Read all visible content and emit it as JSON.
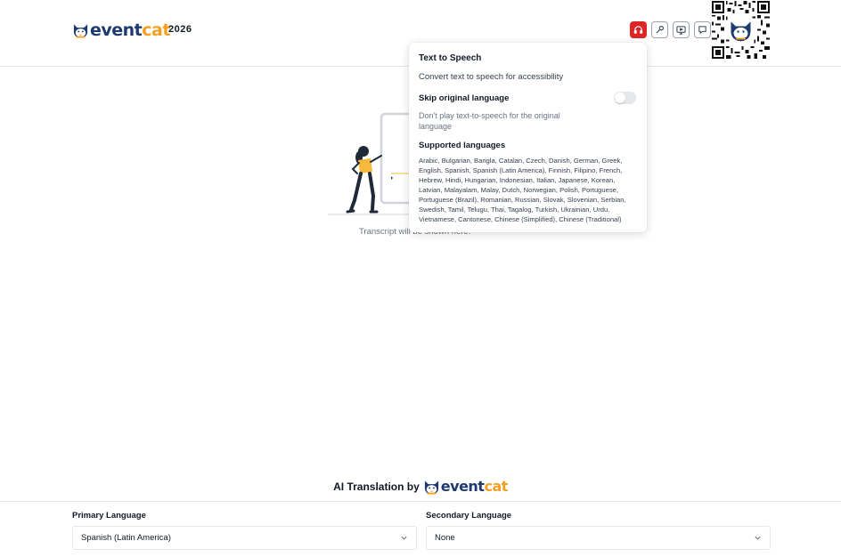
{
  "header": {
    "brand_part1": "event",
    "brand_part2": "cat",
    "year": "2026",
    "icons": [
      "headphones-icon",
      "wrench-icon",
      "screen-icon",
      "chat-icon"
    ],
    "active_color": "#dc2626"
  },
  "main": {
    "transcript_placeholder": "Transcript will be shown here."
  },
  "popover": {
    "title": "Text to Speech",
    "description": "Convert text to speech for accessibility",
    "skip_label": "Skip original language",
    "skip_enabled": false,
    "skip_description": "Don't play text-to-speech for the original language",
    "supported_title": "Supported languages",
    "supported_list": "Arabic, Bulgarian, Bangla, Catalan, Czech, Danish, German, Greek, English, Spanish, Spanish (Latin America), Finnish, Filipino, French, Hebrew, Hindi, Hungarian, Indonesian, Italian, Japanese, Korean, Latvian, Malayalam, Malay, Dutch, Norwegian, Polish, Portuguese, Portuguese (Brazil), Romanian, Russian, Slovak, Slovenian, Serbian, Swedish, Tamil, Telugu, Thai, Tagalog, Turkish, Ukrainian, Urdu, Vietnamese, Cantonese, Chinese (Simplified), Chinese (Traditional)"
  },
  "footer": {
    "ai_label": "AI Translation by",
    "brand_part1": "event",
    "brand_part2": "cat",
    "primary_label": "Primary Language",
    "primary_value": "Spanish (Latin America)",
    "secondary_label": "Secondary Language",
    "secondary_value": "None"
  },
  "colors": {
    "brand_navy": "#1e3a6e",
    "brand_orange": "#f5a020",
    "illustration_yellow": "#f5b93c"
  }
}
